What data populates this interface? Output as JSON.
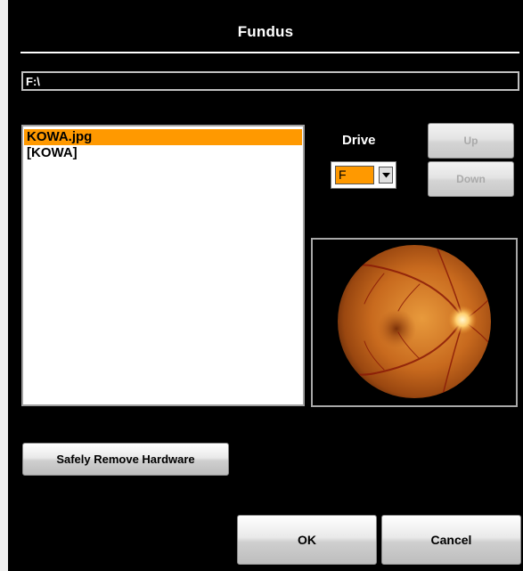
{
  "dialog": {
    "title": "Fundus",
    "path": "F:\\"
  },
  "file_list": {
    "items": [
      {
        "label": "KOWA.jpg",
        "selected": true
      },
      {
        "label": "[KOWA]",
        "selected": false
      }
    ]
  },
  "drive": {
    "label": "Drive",
    "selected": "F"
  },
  "nav": {
    "up_label": "Up",
    "down_label": "Down"
  },
  "buttons": {
    "safely_remove_label": "Safely Remove Hardware",
    "ok_label": "OK",
    "cancel_label": "Cancel"
  },
  "colors": {
    "accent": "#ff9900",
    "background": "#000000"
  }
}
